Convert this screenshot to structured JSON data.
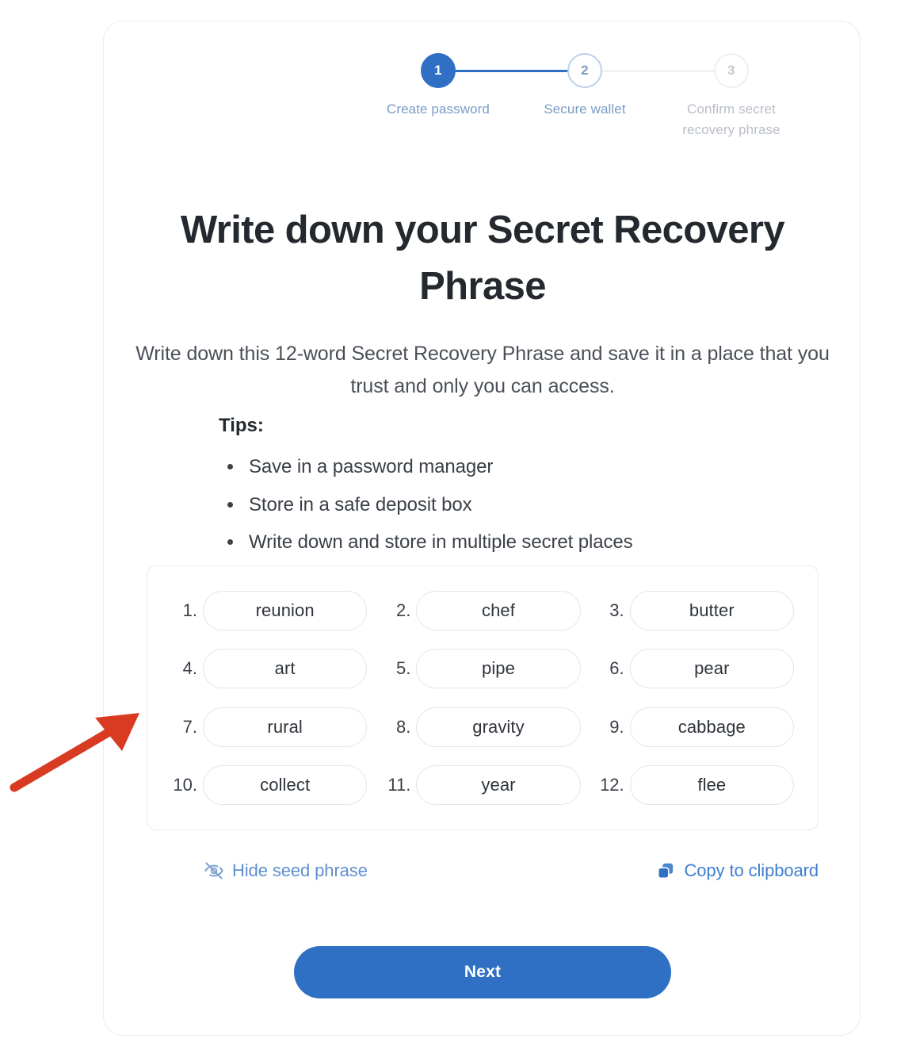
{
  "stepper": {
    "steps": [
      {
        "number": "1",
        "label": "Create password",
        "state": "active"
      },
      {
        "number": "2",
        "label": "Secure wallet",
        "state": "current"
      },
      {
        "number": "3",
        "label": "Confirm secret\nrecovery phrase",
        "state": "upcoming"
      }
    ]
  },
  "page": {
    "title": "Write down your Secret Recovery Phrase",
    "subtitle": "Write down this 12-word Secret Recovery Phrase and save it in a place that you trust and only you can access."
  },
  "tips": {
    "heading": "Tips:",
    "items": [
      "Save in a password manager",
      "Store in a safe deposit box",
      "Write down and store in multiple secret places"
    ]
  },
  "seed_phrase": {
    "words": [
      {
        "index": "1.",
        "word": "reunion"
      },
      {
        "index": "2.",
        "word": "chef"
      },
      {
        "index": "3.",
        "word": "butter"
      },
      {
        "index": "4.",
        "word": "art"
      },
      {
        "index": "5.",
        "word": "pipe"
      },
      {
        "index": "6.",
        "word": "pear"
      },
      {
        "index": "7.",
        "word": "rural"
      },
      {
        "index": "8.",
        "word": "gravity"
      },
      {
        "index": "9.",
        "word": "cabbage"
      },
      {
        "index": "10.",
        "word": "collect"
      },
      {
        "index": "11.",
        "word": "year"
      },
      {
        "index": "12.",
        "word": "flee"
      }
    ]
  },
  "actions": {
    "hide_label": "Hide seed phrase",
    "hide_icon": "eye-off-icon",
    "copy_label": "Copy to clipboard",
    "copy_icon": "copy-icon"
  },
  "footer": {
    "next_label": "Next"
  },
  "colors": {
    "accent_blue": "#2f6fc4",
    "link_blue": "#3f7fd0",
    "step_inactive": "#b9bec6",
    "annotation_red": "#d93a22",
    "card_border": "#ececec"
  }
}
